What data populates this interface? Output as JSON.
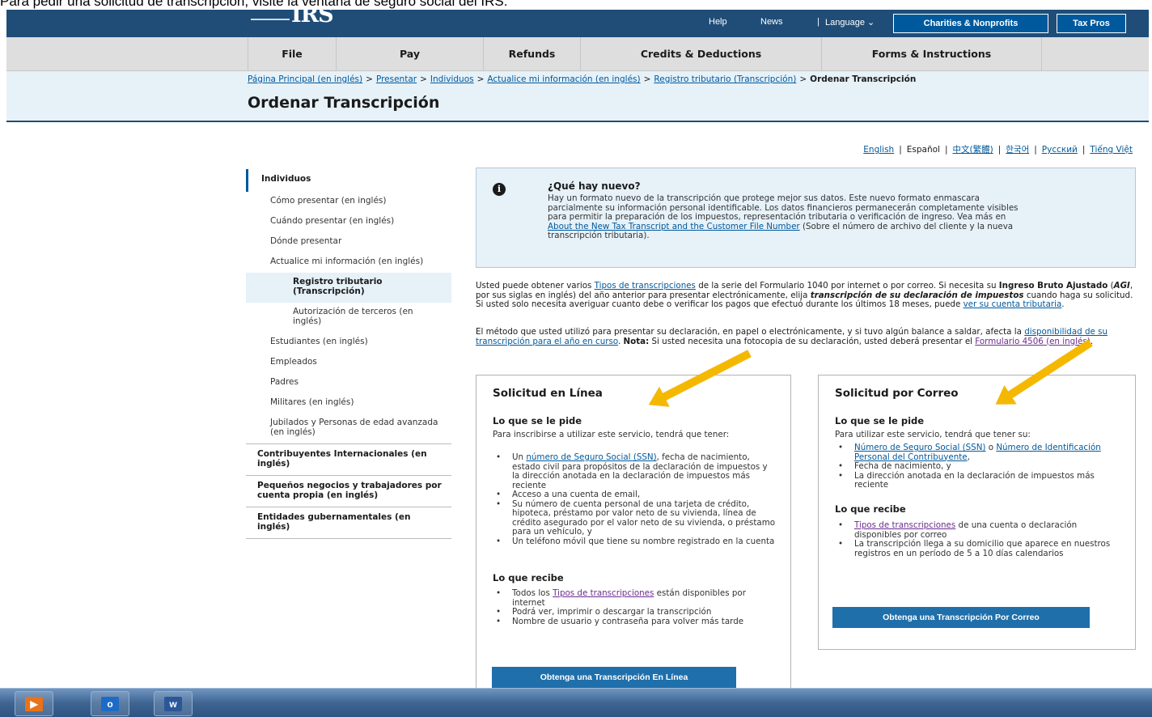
{
  "caption": "Para pedir una solicitud de transcripción, visite la ventana de seguro social del IRS.",
  "header": {
    "logo": "IRS",
    "help": "Help",
    "news": "News",
    "separator": "|",
    "language": "Language ⌄",
    "charities_button": "Charities & Nonprofits",
    "taxpros_button": "Tax Pros"
  },
  "nav": {
    "file": "File",
    "pay": "Pay",
    "refunds": "Refunds",
    "credits": "Credits & Deductions",
    "forms": "Forms & Instructions"
  },
  "breadcrumb": {
    "items": [
      "Página Principal (en inglés)",
      "Presentar",
      "Individuos",
      "Actualice mi información (en inglés)",
      "Registro tributario (Transcripción)"
    ],
    "separator": ">",
    "current": "Ordenar Transcripción"
  },
  "page_title": "Ordenar Transcripción",
  "languages": {
    "separator": "|",
    "items": [
      "English",
      "Español",
      "中文(繁體)",
      "한국어",
      "Русский",
      "Tiếng Việt"
    ]
  },
  "sidebar": {
    "heading": "Individuos",
    "items": [
      "Cómo presentar (en inglés)",
      "Cuándo presentar (en inglés)",
      "Dónde presentar",
      "Actualice mi información (en inglés)",
      "Registro tributario (Transcripción)",
      "Autorización de terceros (en inglés)",
      "Estudiantes (en inglés)",
      "Empleados",
      "Padres",
      "Militares (en inglés)",
      "Jubilados y Personas de edad avanzada (en inglés)"
    ],
    "top_sections": [
      "Contribuyentes Internacionales (en inglés)",
      "Pequeños negocios y trabajadores por cuenta propia (en inglés)",
      "Entidades gubernamentales (en inglés)"
    ]
  },
  "alert": {
    "icon": "info-icon",
    "title": "¿Qué hay nuevo?",
    "text": "Hay un formato nuevo de la transcripción que protege mejor sus datos. Este nuevo formato enmascara parcialmente su información personal identificable. Los datos financieros permanecerán completamente visibles para permitir la preparación de los impuestos, representación tributaria o verificación de ingreso. Vea más en",
    "link": "About the New Tax Transcript and the Customer File Number",
    "after_link": "(Sobre el número de archivo del cliente y la nueva transcripción tributaria)."
  },
  "intro": {
    "p1_a": "Usted puede obtener varios",
    "p1_link1": "Tipos de transcripciones",
    "p1_b": "de la serie del Formulario 1040 por internet o por correo.  Si necesita su",
    "p1_bold": "Ingreso Bruto Ajustado",
    "p1_c": "(",
    "p1_agi": "AGI",
    "p1_d": ", por sus siglas en inglés) del año anterior para presentar electrónicamente, elija",
    "p1_boldital": "transcripción de su declaración de impuestos",
    "p1_e": "cuando haga su solicitud. Si usted solo necesita averiguar cuanto debe o verificar los pagos que efectuó durante los últimos 18 meses, puede",
    "p1_link2": "ver su cuenta tributaria",
    "p1_f": ".",
    "p2_a": "El método que usted utilizó para presentar su declaración, en papel o electrónicamente, y si tuvo algún balance a saldar, afecta la",
    "p2_link1": "disponibilidad de su transcripción para el año en curso",
    "p2_b": ".",
    "p2_bold": "Nota:",
    "p2_c": "Si usted necesita una fotocopia de su declaración, usted deberá presentar el",
    "p2_link2": "Formulario 4506 (en inglés)",
    "p2_d": "."
  },
  "online": {
    "title": "Solicitud en Línea",
    "asked_heading": "Lo que se le pide",
    "asked_intro": "Para inscribirse a utilizar este servicio, tendrá que tener:",
    "req1_a": "Un",
    "req1_link": "número de Seguro Social (SSN)",
    "req1_b": ", fecha de nacimiento, estado civil para propósitos de la declaración de impuestos y la dirección anotada en la declaración de impuestos más reciente",
    "req2": "Acceso a una cuenta de email,",
    "req3": "Su número de cuenta personal de una tarjeta de crédito, hipoteca, préstamo por valor neto de su vivienda, línea de crédito asegurado por el valor neto de su vivienda, o préstamo para un vehículo, y",
    "req4": "Un teléfono móvil que tiene su nombre registrado en la cuenta",
    "receive_heading": "Lo que recibe",
    "rec1_a": "Todos los",
    "rec1_link": "Tipos de transcripciones",
    "rec1_b": "están disponibles por internet",
    "rec2": "Podrá ver, imprimir o descargar la transcripción",
    "rec3": "Nombre de usuario y contraseña para volver más tarde",
    "button": "Obtenga una Transcripción En Línea"
  },
  "mail": {
    "title": "Solicitud por Correo",
    "asked_heading": "Lo que se le pide",
    "asked_intro": "Para utilizar este servicio, tendrá que tener su:",
    "req1_link1": "Número de Seguro Social (SSN)",
    "req1_or": "o",
    "req1_link2": "Número de Identificación Personal del Contribuyente",
    "req1_end": ",",
    "req2": "Fecha de nacimiento, y",
    "req3": "La dirección anotada en la declaración de impuestos más reciente",
    "receive_heading": "Lo que recibe",
    "rec1_link": "Tipos de transcripciones",
    "rec1_b": "de una cuenta o declaración disponibles por correo",
    "rec2": "La transcripción llega a su domicilio que aparece en nuestros registros en un período de 5 a 10 días calendarios",
    "button": "Obtenga una Transcripción Por Correo"
  },
  "taskbar": {
    "apps": [
      {
        "icon": "media-player-icon",
        "color": "#e8731a"
      },
      {
        "icon": "outlook-icon",
        "label": "o",
        "color": "#1e6bc6"
      },
      {
        "icon": "word-icon",
        "label": "w",
        "color": "#2b579a"
      }
    ]
  },
  "colors": {
    "header_blue": "#1f4d78",
    "link_blue": "#00599c",
    "annotation_arrow": "#f5b800",
    "button_blue": "#1f6fab"
  }
}
